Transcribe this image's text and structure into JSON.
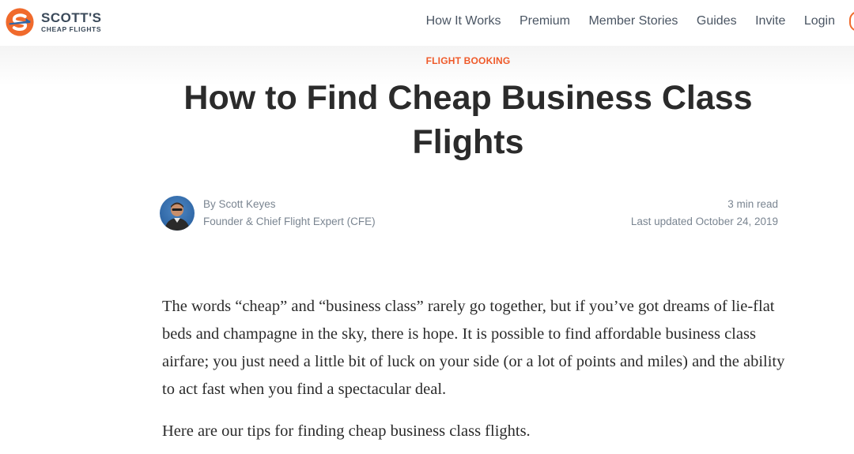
{
  "brand": {
    "name": "SCOTT'S",
    "tagline": "CHEAP FLIGHTS",
    "colors": {
      "orange": "#f06a2c",
      "navy": "#3b4a5a",
      "blue": "#2f67a6"
    }
  },
  "nav": {
    "items": [
      {
        "label": "How It Works"
      },
      {
        "label": "Premium"
      },
      {
        "label": "Member Stories"
      },
      {
        "label": "Guides"
      },
      {
        "label": "Invite"
      },
      {
        "label": "Login"
      }
    ]
  },
  "article": {
    "category": "FLIGHT BOOKING",
    "title": "How to Find Cheap Business Class Flights",
    "author": {
      "byline": "By Scott Keyes",
      "role": "Founder & Chief Flight Expert (CFE)"
    },
    "read_time": "3 min read",
    "updated": "Last updated October 24, 2019",
    "paragraphs": [
      "The words “cheap” and “business class” rarely go together, but if you’ve got dreams of lie-flat beds and champagne in the sky, there is hope. It is possible to find affordable business class airfare; you just need a little bit of luck on your side (or a lot of points and miles) and the ability to act fast when you find a spectacular deal.",
      "Here are our tips for finding cheap business class flights."
    ]
  }
}
